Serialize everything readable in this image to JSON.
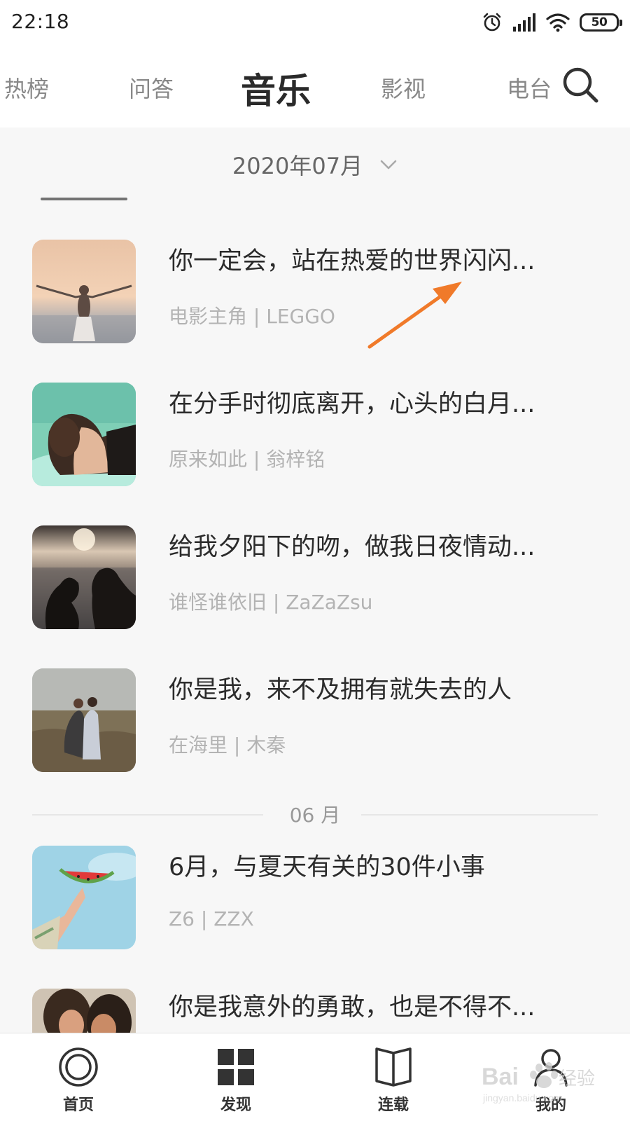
{
  "status_bar": {
    "time": "22:18",
    "battery": "50",
    "icons": [
      "alarm-icon",
      "signal-icon",
      "wifi-icon",
      "battery-icon"
    ]
  },
  "tabs": [
    {
      "label": "热榜",
      "active": false
    },
    {
      "label": "问答",
      "active": false
    },
    {
      "label": "音乐",
      "active": true
    },
    {
      "label": "影视",
      "active": false
    },
    {
      "label": "电台",
      "active": false
    }
  ],
  "search": {
    "icon": "search-icon"
  },
  "month_picker": {
    "label": "2020年07月",
    "icon": "chevron-down-icon"
  },
  "list": [
    {
      "title": "你一定会，站在热爱的世界闪闪...",
      "subtitle": "电影主角 | LEGGO"
    },
    {
      "title": "在分手时彻底离开，心头的白月...",
      "subtitle": "原来如此 | 翁梓铭"
    },
    {
      "title": "给我夕阳下的吻，做我日夜情动...",
      "subtitle": "谁怪谁依旧 | ZaZaZsu"
    },
    {
      "title": "你是我，来不及拥有就失去的人",
      "subtitle": "在海里 | 木秦"
    }
  ],
  "divider": {
    "label": "06 月"
  },
  "list_june": [
    {
      "title": "6月，与夏天有关的30件小事",
      "subtitle": "Z6 | ZZX"
    },
    {
      "title": "你是我意外的勇敢，也是不得不...",
      "subtitle": ""
    }
  ],
  "bottom_nav": [
    {
      "label": "首页",
      "icon": "home-ring-icon"
    },
    {
      "label": "发现",
      "icon": "grid-icon"
    },
    {
      "label": "连载",
      "icon": "book-icon"
    },
    {
      "label": "我的",
      "icon": "person-icon"
    }
  ],
  "watermark": {
    "text": "Bai 经验",
    "subtext": "jingyan.baidu.com"
  },
  "colors": {
    "annotation_arrow": "#f07a2a",
    "background": "#f7f7f7"
  }
}
